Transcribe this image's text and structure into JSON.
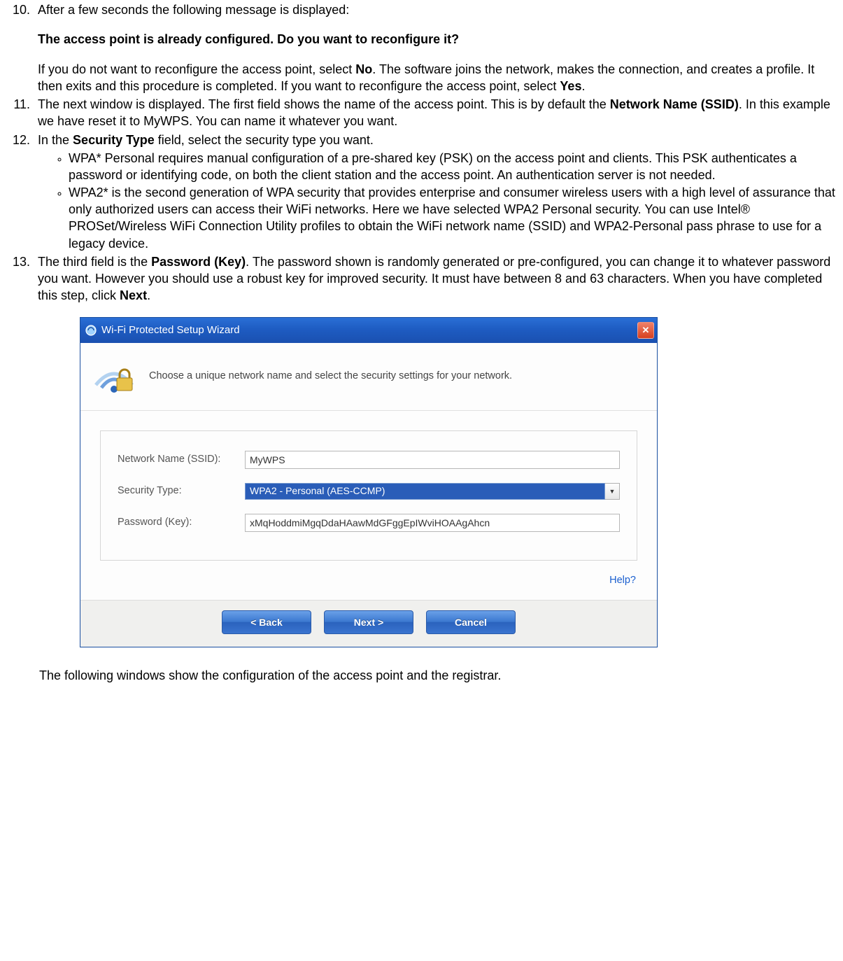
{
  "list_start": 10,
  "items": {
    "10": {
      "intro": "After a few seconds the following message is displayed:",
      "bold_line": "The access point is already configured. Do you want to reconfigure it?",
      "post1a": "If you do not want to reconfigure the access point, select ",
      "post1_bold1": "No",
      "post1b": ". The software joins the network, makes the connection, and creates a profile. It then exits and this procedure is completed. If you want to reconfigure the access point, select ",
      "post1_bold2": "Yes",
      "post1c": "."
    },
    "11": {
      "a": "The next window is displayed. The first field shows the name of the access point. This is by default the ",
      "bold": "Network Name (SSID)",
      "b": ". In this example we have reset it to MyWPS. You can name it whatever you want."
    },
    "12": {
      "a": "In the ",
      "bold": "Security Type",
      "b": " field, select the security type you want.",
      "sub": [
        "WPA* Personal requires manual configuration of a pre-shared key (PSK) on the access point and clients. This PSK authenticates a password or identifying code, on both the client station and the access point. An authentication server is not needed.",
        "WPA2* is the second generation of WPA security that provides enterprise and consumer wireless users with a high level of assurance that only authorized users can access their WiFi networks. Here we have selected WPA2 Personal security. You can use Intel® PROSet/Wireless WiFi Connection Utility profiles to obtain the WiFi network name (SSID) and WPA2-Personal pass phrase to use for a legacy device."
      ]
    },
    "13": {
      "a": "The third field is the ",
      "bold1": "Password (Key)",
      "b": ". The password shown is randomly generated or pre-configured, you can change it to whatever password you want. However you should use a robust key for improved security. It must have between 8 and 63 characters. When you have completed this step, click ",
      "bold2": "Next",
      "c": "."
    }
  },
  "dialog": {
    "title": "Wi-Fi Protected Setup Wizard",
    "banner_text": "Choose a unique network name and select the security settings for your network.",
    "labels": {
      "ssid": "Network Name (SSID):",
      "sectype": "Security Type:",
      "password": "Password (Key):"
    },
    "values": {
      "ssid": "MyWPS",
      "sectype": "WPA2 - Personal (AES-CCMP)",
      "password": "xMqHoddmiMgqDdaHAawMdGFggEpIWviHOAAgAhcn"
    },
    "help": "Help?",
    "buttons": {
      "back": "<  Back",
      "next": "Next  >",
      "cancel": "Cancel"
    },
    "close_glyph": "✕"
  },
  "after": "The following windows show the configuration of the access point and the registrar."
}
